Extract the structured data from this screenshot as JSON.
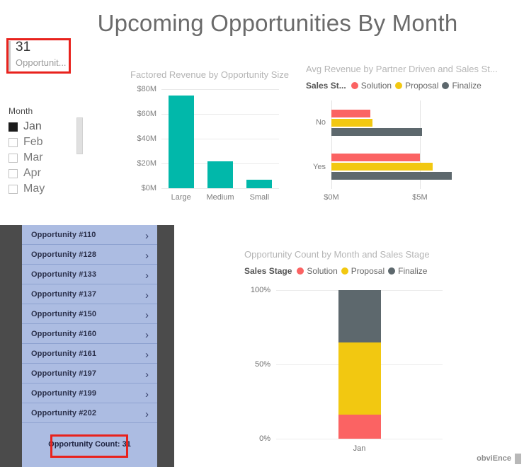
{
  "report": {
    "title": "Upcoming Opportunities By Month",
    "watermark": "obviEnce"
  },
  "kpi_card": {
    "value": "31",
    "label": "Opportunit...",
    "accent_color": "#c8c8c8",
    "annotation_color": "#e8221d"
  },
  "month_slicer": {
    "header": "Month",
    "items": [
      {
        "label": "Jan",
        "selected": true
      },
      {
        "label": "Feb",
        "selected": false
      },
      {
        "label": "Mar",
        "selected": false
      },
      {
        "label": "Apr",
        "selected": false
      },
      {
        "label": "May",
        "selected": false
      }
    ]
  },
  "opportunity_list": {
    "rows": [
      {
        "label": "Opportunity #110",
        "chevron": "chevron-right-icon"
      },
      {
        "label": "Opportunity #128",
        "chevron": "chevron-right-icon"
      },
      {
        "label": "Opportunity #133",
        "chevron": "chevron-right-icon"
      },
      {
        "label": "Opportunity #137",
        "chevron": "chevron-right-icon"
      },
      {
        "label": "Opportunity #150",
        "chevron": "chevron-right-icon"
      },
      {
        "label": "Opportunity #160",
        "chevron": "chevron-right-icon"
      },
      {
        "label": "Opportunity #161",
        "chevron": "chevron-right-icon"
      },
      {
        "label": "Opportunity #197",
        "chevron": "chevron-right-icon"
      },
      {
        "label": "Opportunity #199",
        "chevron": "chevron-right-icon"
      },
      {
        "label": "Opportunity #202",
        "chevron": "chevron-right-icon"
      }
    ],
    "footer": "Opportunity Count: 31",
    "row_color": "#acbce2",
    "panel_color": "#4b4b4b"
  },
  "chart_data": [
    {
      "id": "factored_revenue",
      "type": "bar",
      "title": "Factored Revenue by Opportunity Size",
      "orientation": "vertical",
      "categories": [
        "Large",
        "Medium",
        "Small"
      ],
      "values": [
        75,
        22,
        7
      ],
      "unit": "$M",
      "xlabel": "",
      "ylabel": "",
      "ylim": [
        0,
        80
      ],
      "yticks": [
        0,
        20,
        40,
        60,
        80
      ],
      "ytick_labels": [
        "$0M",
        "$20M",
        "$40M",
        "$60M",
        "$80M"
      ],
      "grid": true,
      "legend": false,
      "series_color": "#01b8aa"
    },
    {
      "id": "avg_revenue",
      "type": "bar",
      "title": "Avg Revenue by Partner Driven and Sales St...",
      "orientation": "horizontal",
      "legend_title": "Sales St...",
      "legend_position": "top",
      "categories": [
        "No",
        "Yes"
      ],
      "series": [
        {
          "name": "Solution",
          "color": "#fb6363",
          "values": [
            2.2,
            5.0
          ]
        },
        {
          "name": "Proposal",
          "color": "#f2c811",
          "values": [
            2.3,
            5.7
          ]
        },
        {
          "name": "Finalize",
          "color": "#5d686d",
          "values": [
            5.1,
            6.8
          ]
        }
      ],
      "unit": "$M",
      "xlim": [
        0,
        9
      ],
      "xticks": [
        0,
        5
      ],
      "xtick_labels": [
        "$0M",
        "$5M"
      ],
      "grid": true,
      "legend": true
    },
    {
      "id": "opportunity_count",
      "type": "bar",
      "stacked": "100%",
      "title": "Opportunity Count by Month and Sales Stage",
      "orientation": "vertical",
      "legend_title": "Sales Stage",
      "legend_position": "top",
      "categories": [
        "Jan"
      ],
      "series": [
        {
          "name": "Solution",
          "color": "#fb6363",
          "values": [
            16
          ]
        },
        {
          "name": "Proposal",
          "color": "#f2c811",
          "values": [
            49
          ]
        },
        {
          "name": "Finalize",
          "color": "#5d686d",
          "values": [
            35
          ]
        }
      ],
      "unit": "%",
      "ylim": [
        0,
        100
      ],
      "yticks": [
        0,
        50,
        100
      ],
      "ytick_labels": [
        "0%",
        "50%",
        "100%"
      ],
      "grid": true,
      "legend": true
    }
  ]
}
